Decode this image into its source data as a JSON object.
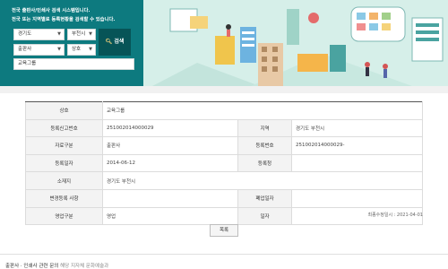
{
  "search": {
    "intro_line1": "전국 출판사/인쇄사 검색 시스템입니다.",
    "intro_line2": "전국 또는 지역별로 등록현황을 검색할 수 있습니다.",
    "region": "경기도",
    "city": "부천시",
    "business_type": "출판사",
    "sort": "상호",
    "button_label": "검색",
    "keyword": "교육그룹"
  },
  "details": {
    "rows": [
      {
        "label1": "상호",
        "value1": "교육그룹",
        "label2": "",
        "value2": ""
      },
      {
        "label1": "등록신고번호",
        "value1": "251002014000029",
        "label2": "지역",
        "value2": "경기도 부천시"
      },
      {
        "label1": "자료구분",
        "value1": "출판사",
        "label2": "등록번호",
        "value2": "251002014000029-"
      },
      {
        "label1": "등록일자",
        "value1": "2014-06-12",
        "label2": "등록청",
        "value2": ""
      },
      {
        "label1": "소재지",
        "value1": "경기도 부천시",
        "label2": "",
        "value2": ""
      },
      {
        "label1": "변경등록 사항",
        "value1": "",
        "label2": "폐업일자",
        "value2": ""
      },
      {
        "label1": "영업구분",
        "value1": "영업",
        "label2": "일자",
        "value2": ""
      }
    ],
    "updated": "최종수정일시 : 2021-04-01"
  },
  "list_button": "목록",
  "footer": {
    "title": "출판사 · 인쇄사 관련 문의",
    "sub": "해당 지자체 문화예술과"
  },
  "colors": {
    "panel": "#0d7a7f",
    "banner_bg": "#d6efe9",
    "button": "#075457"
  }
}
